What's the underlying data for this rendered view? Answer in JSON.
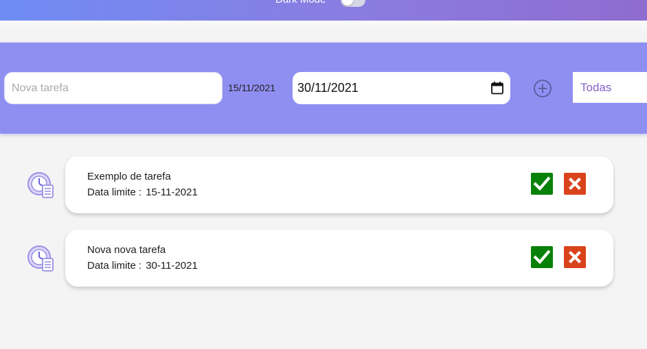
{
  "header": {
    "dark_mode_label": "Dark Mode",
    "gradient": [
      "#6f8cf5",
      "#8f6ccf"
    ]
  },
  "toolbar": {
    "background": "#8f8ff2",
    "task_input": {
      "placeholder": "Nova tarefa",
      "value": ""
    },
    "today_label": "15/11/2021",
    "due_date_value": "30/11/2021",
    "calendar_icon": "calendar-icon",
    "add_icon": "plus-circle-icon",
    "filter": {
      "selected": "Todas"
    }
  },
  "tasks": [
    {
      "name": "Exemplo de tarefa",
      "due_label": "Data limite :",
      "due_date": "15-11-2021",
      "icon": "clock-checklist-icon"
    },
    {
      "name": "Nova nova tarefa",
      "due_label": "Data limite :",
      "due_date": "30-11-2021",
      "icon": "clock-checklist-icon"
    }
  ],
  "colors": {
    "complete": "#078107",
    "delete": "#d9431b",
    "accent_text": "#7f62c9"
  }
}
